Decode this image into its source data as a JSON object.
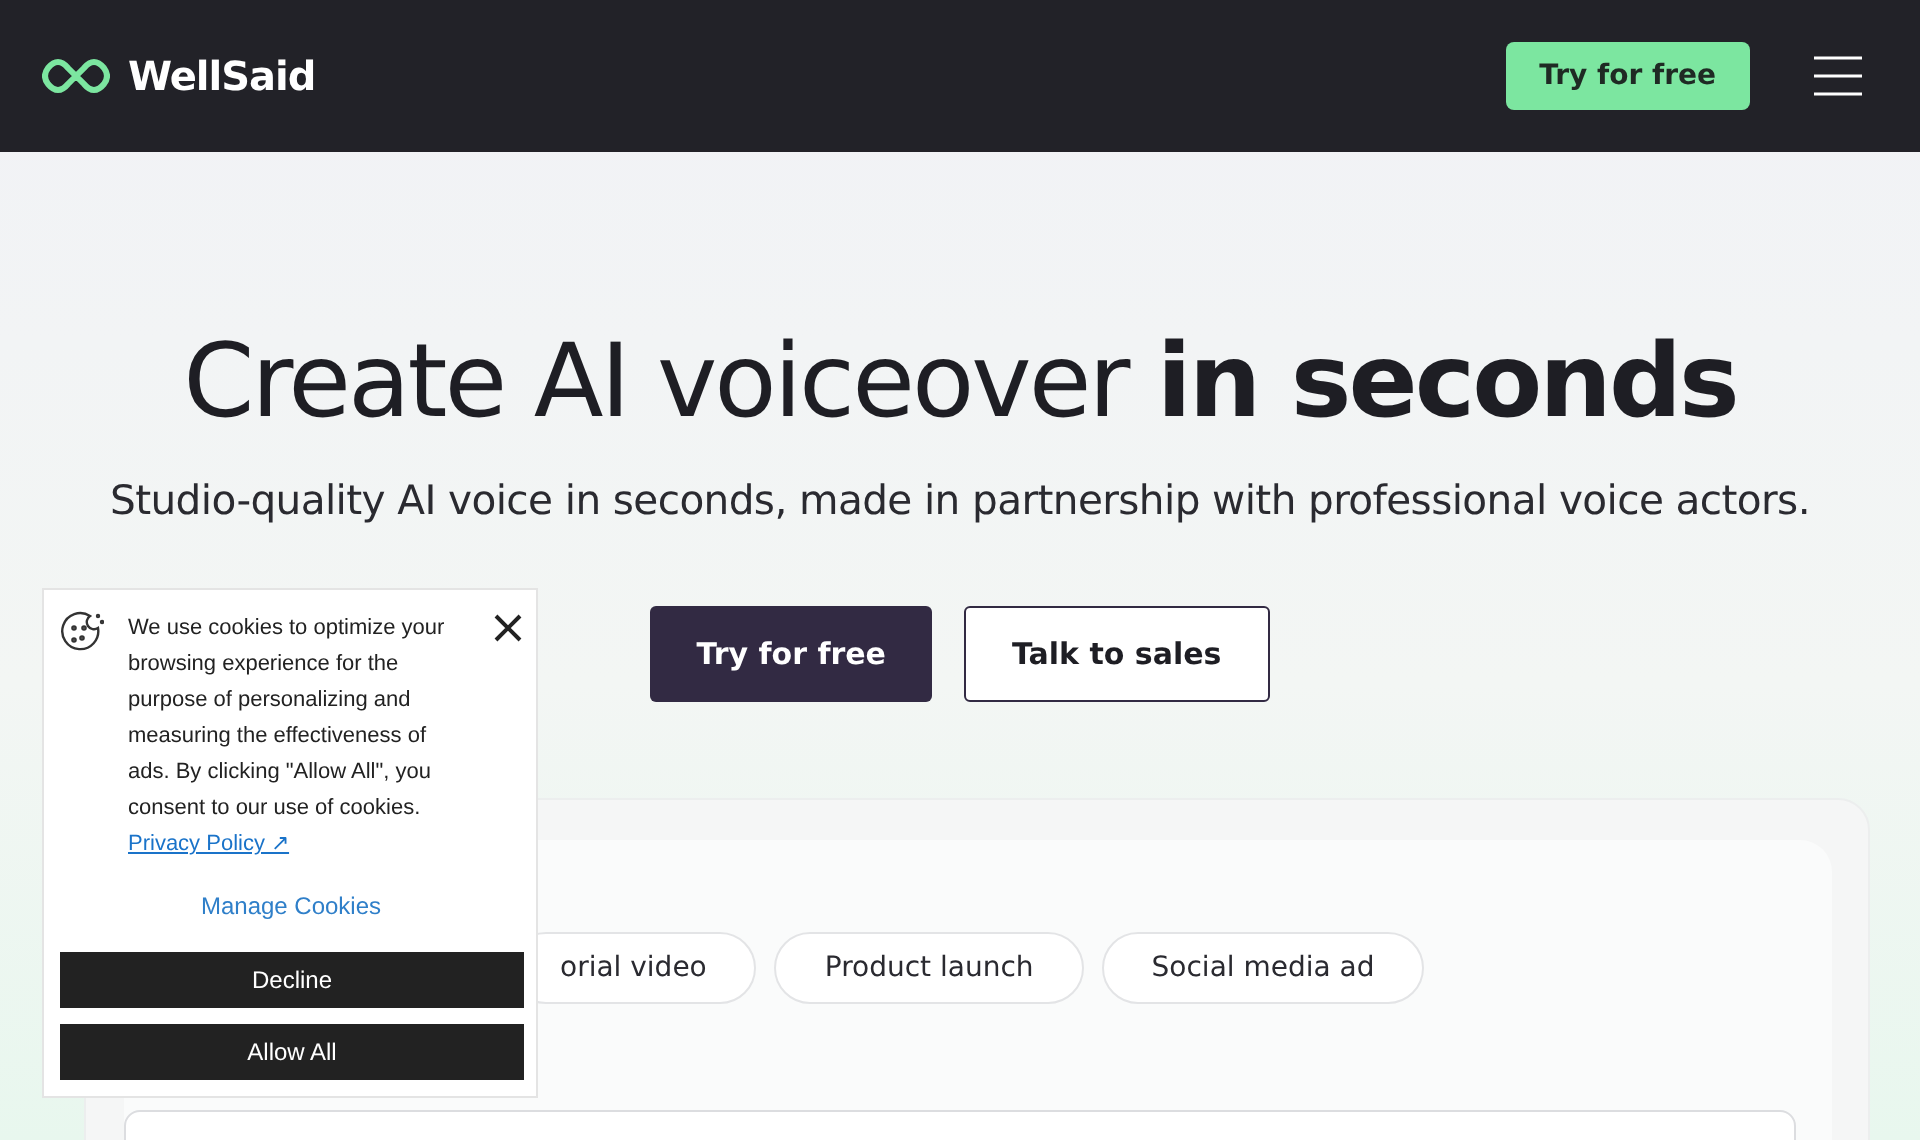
{
  "header": {
    "brand": "WellSaid",
    "cta": "Try for free"
  },
  "hero": {
    "title": "Create AI voiceover **in seconds**",
    "subtitle": "Studio-quality AI voice in seconds, made in partnership with professional voice actors.",
    "buttons": [
      {
        "label": "Try for free",
        "kind": "primary"
      },
      {
        "label": "Talk to sales",
        "kind": "outline"
      }
    ]
  },
  "demo": {
    "chips": [
      {
        "label": "orial video"
      },
      {
        "label": "Product launch"
      },
      {
        "label": "Social media ad"
      }
    ]
  },
  "cookie_banner": {
    "message": "We use cookies to optimize your browsing experience for the purpose of personalizing and measuring the effectiveness of ads. By clicking \"Allow All\", you consent to our use of cookies.",
    "privacy_link": "Privacy Policy ↗",
    "manage": "Manage Cookies",
    "buttons": [
      "Decline",
      "Allow All"
    ]
  }
}
